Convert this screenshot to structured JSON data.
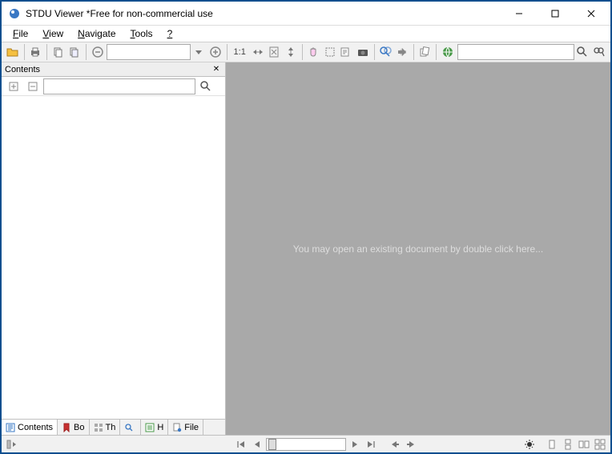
{
  "titlebar": {
    "title": "STDU Viewer *Free for non-commercial use"
  },
  "menus": {
    "file": "File",
    "view": "View",
    "navigate": "Navigate",
    "tools": "Tools",
    "help": "?"
  },
  "toolbar": {
    "zoom_ratio": "1:1",
    "zoom_value": "",
    "search_value": ""
  },
  "sidebar": {
    "panel_title": "Contents",
    "search_value": "",
    "tabs": {
      "contents": "Contents",
      "bookmarks": "Bo",
      "thumbnails": "Th",
      "search": "",
      "history": "H",
      "files": "File"
    }
  },
  "main": {
    "hint": "You may open an existing document by double click here..."
  }
}
